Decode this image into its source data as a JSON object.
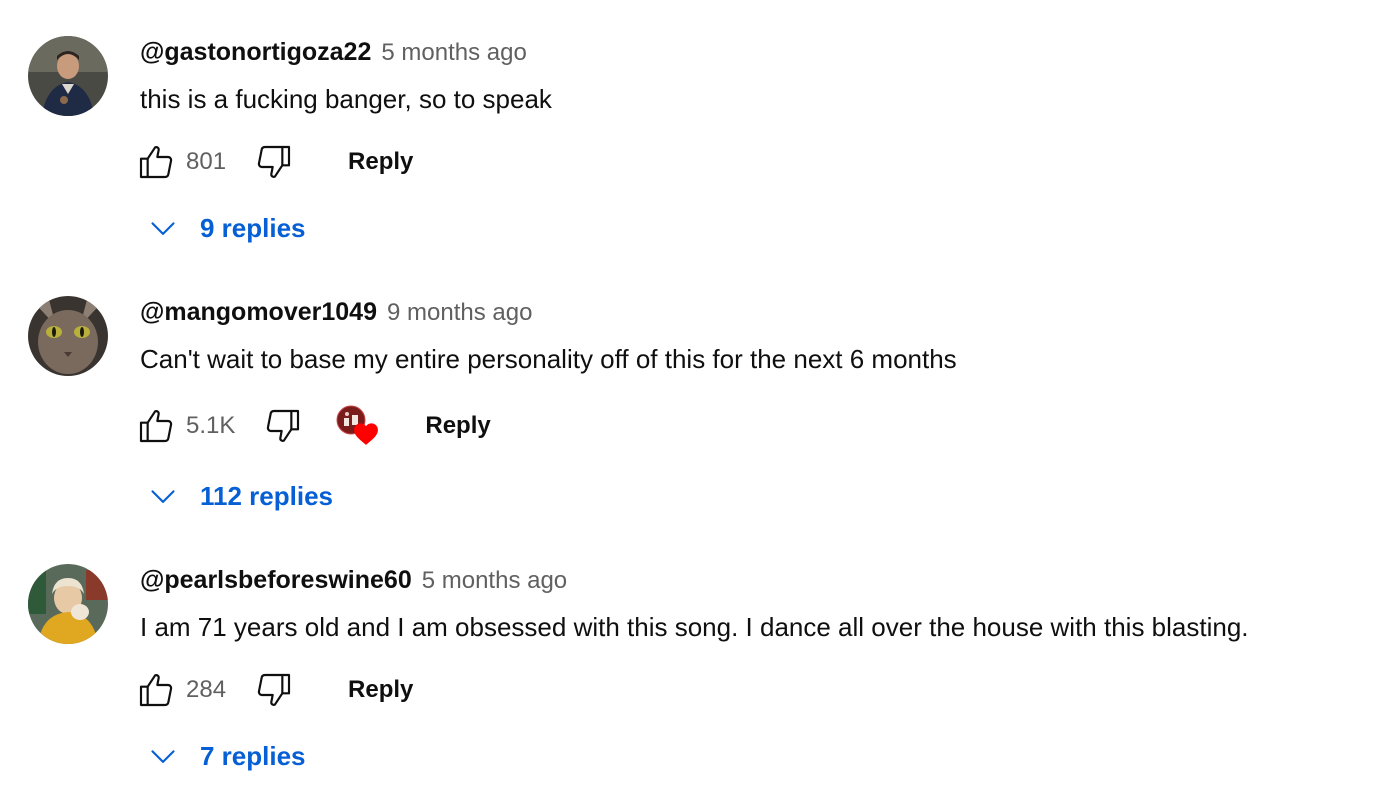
{
  "comments": [
    {
      "author": "@gastonortigoza22",
      "time": "5 months ago",
      "text": "this is a fucking banger, so to speak",
      "likes": "801",
      "reply_label": "Reply",
      "replies_label": "9 replies",
      "creator_heart": false
    },
    {
      "author": "@mangomover1049",
      "time": "9 months ago",
      "text": "Can't wait to base my entire personality off of this for the next 6 months",
      "likes": "5.1K",
      "reply_label": "Reply",
      "replies_label": "112 replies",
      "creator_heart": true
    },
    {
      "author": "@pearlsbeforeswine60",
      "time": "5 months ago",
      "text": "I am 71 years old and I am obsessed with this song. I dance all over the house with this blasting.",
      "likes": "284",
      "reply_label": "Reply",
      "replies_label": "7 replies",
      "creator_heart": false
    }
  ],
  "colors": {
    "link_blue": "#065fd4",
    "secondary_text": "#606060",
    "primary_text": "#0f0f0f",
    "heart_red": "#ff0000"
  },
  "icons": {
    "like": "thumbs-up-icon",
    "dislike": "thumbs-down-icon",
    "expand": "chevron-down-icon",
    "creator_heart": "heart-icon"
  }
}
